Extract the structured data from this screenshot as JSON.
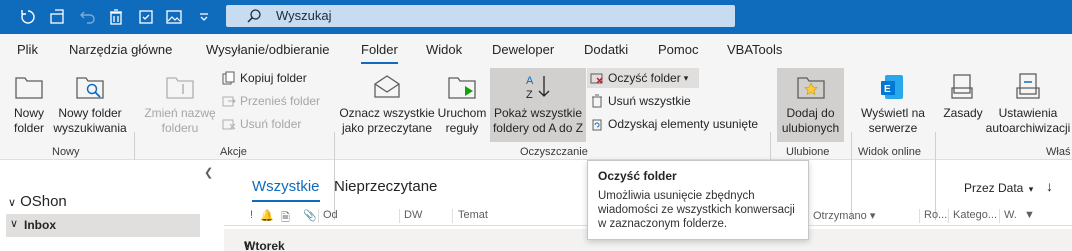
{
  "search": {
    "placeholder": "Wyszukaj"
  },
  "tabs": [
    "Plik",
    "Narzędzia główne",
    "Wysyłanie/odbieranie",
    "Folder",
    "Widok",
    "Deweloper",
    "Dodatki",
    "Pomoc",
    "VBATools"
  ],
  "active_tab": "Folder",
  "ribbon": {
    "nowy_folder": "Nowy folder",
    "nowy_folder_wyszukiwania": "Nowy folder wyszukiwania",
    "zmien_nazwe_folderu": "Zmień nazwę folderu",
    "kopiuj_folder": "Kopiuj folder",
    "przenies_folder": "Przenieś folder",
    "usun_folder": "Usuń folder",
    "oznacz_wszystkie": "Oznacz wszystkie jako przeczytane",
    "uruchom_reguly": "Uruchom reguły",
    "pokaz_wszystkie": "Pokaż wszystkie foldery od A do Z",
    "oczysc_folder": "Oczyść folder",
    "usun_wszystkie": "Usuń wszystkie",
    "odzyskaj": "Odzyskaj elementy usunięte",
    "dodaj_do_ulubionych": "Dodaj do ulubionych",
    "wyswietl_na_serwerze": "Wyświetl na serwerze",
    "zasady": "Zasady",
    "ustawienia_autoarchiwizacji": "Ustawienia autoarchiwizacji",
    "groups": {
      "nowy": "Nowy",
      "akcje": "Akcje",
      "oczyszczanie": "Oczyszczanie",
      "ulubione": "Ulubione",
      "widok_online": "Widok online",
      "wlasciwosci": "Właś"
    }
  },
  "nav": {
    "account": "OShon",
    "inbox": "Inbox"
  },
  "list": {
    "tab_all": "Wszystkie",
    "tab_unread": "Nieprzeczytane",
    "sort_by": "Przez Data",
    "columns": {
      "od": "Od",
      "dw": "DW",
      "temat": "Temat",
      "otrzymano": "Otrzymano",
      "ro": "Ro...",
      "kategorie": "Katego...",
      "w": "W."
    },
    "group_label": "Wtorek"
  },
  "tooltip": {
    "title": "Oczyść folder",
    "body": "Umożliwia usunięcie zbędnych wiadomości ze wszystkich konwersacji w zaznaczonym folderze."
  },
  "colors": {
    "accent": "#0f6cbd",
    "titlebar": "#0f6cbd",
    "search_bg": "#c7dcf1"
  }
}
